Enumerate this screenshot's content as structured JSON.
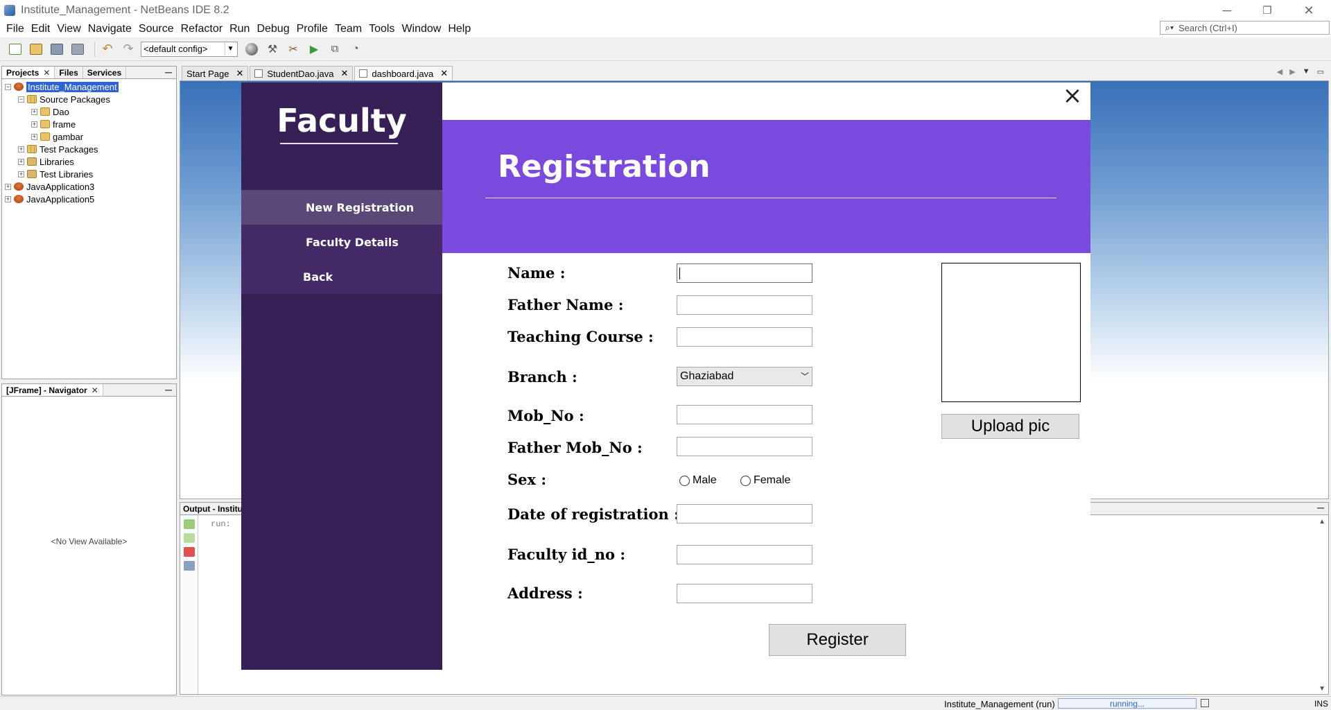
{
  "window": {
    "title": "Institute_Management - NetBeans IDE 8.2",
    "minimize": "─",
    "restore": "❐",
    "close": "✕"
  },
  "menubar": [
    "File",
    "Edit",
    "View",
    "Navigate",
    "Source",
    "Refactor",
    "Run",
    "Debug",
    "Profile",
    "Team",
    "Tools",
    "Window",
    "Help"
  ],
  "search": {
    "placeholder": "Search (Ctrl+I)"
  },
  "toolbar": {
    "config": "<default config>"
  },
  "projects_panel": {
    "tabs": [
      "Projects",
      "Files",
      "Services"
    ],
    "tree": [
      {
        "label": "Institute_Management",
        "level": 0,
        "toggle": "−",
        "icon": "project-icon",
        "selected": true
      },
      {
        "label": "Source Packages",
        "level": 1,
        "toggle": "−",
        "icon": "source-packages-icon"
      },
      {
        "label": "Dao",
        "level": 2,
        "toggle": "+",
        "icon": "package-icon"
      },
      {
        "label": "frame",
        "level": 2,
        "toggle": "+",
        "icon": "package-icon"
      },
      {
        "label": "gambar",
        "level": 2,
        "toggle": "+",
        "icon": "package-icon"
      },
      {
        "label": "Test Packages",
        "level": 1,
        "toggle": "+",
        "icon": "test-packages-icon"
      },
      {
        "label": "Libraries",
        "level": 1,
        "toggle": "+",
        "icon": "libraries-icon"
      },
      {
        "label": "Test Libraries",
        "level": 1,
        "toggle": "+",
        "icon": "libraries-icon"
      },
      {
        "label": "JavaApplication3",
        "level": 0,
        "toggle": "+",
        "icon": "project-icon"
      },
      {
        "label": "JavaApplication5",
        "level": 0,
        "toggle": "+",
        "icon": "project-icon"
      }
    ]
  },
  "navigator": {
    "title": "[JFrame] - Navigator",
    "empty": "<No View Available>"
  },
  "editor_tabs": [
    "Start Page",
    "StudentDao.java",
    "dashboard.java"
  ],
  "output": {
    "title": "Output - Institu",
    "text": "run:"
  },
  "status": {
    "process": "Institute_Management (run)",
    "progress": "running...",
    "mode": "INS"
  },
  "app": {
    "sidebar": {
      "title": "Faculty",
      "items": [
        "New Registration",
        "Faculty Details",
        "Back"
      ]
    },
    "close": "×",
    "header": "Registration",
    "form": {
      "name_label": "Name :",
      "father_name_label": "Father Name :",
      "teaching_course_label": "Teaching Course :",
      "branch_label": "Branch :",
      "branch_value": "Ghaziabad",
      "mob_label": "Mob_No :",
      "father_mob_label": "Father Mob_No :",
      "sex_label": "Sex :",
      "sex_options": [
        "Male",
        "Female"
      ],
      "date_label": "Date of registration :",
      "faculty_id_label": "Faculty id_no :",
      "address_label": "Address :"
    },
    "upload_button": "Upload pic",
    "register_button": "Register"
  },
  "colors": {
    "sidebar": "#362056",
    "banner": "#7a49dd",
    "selection": "#2f63d2"
  }
}
